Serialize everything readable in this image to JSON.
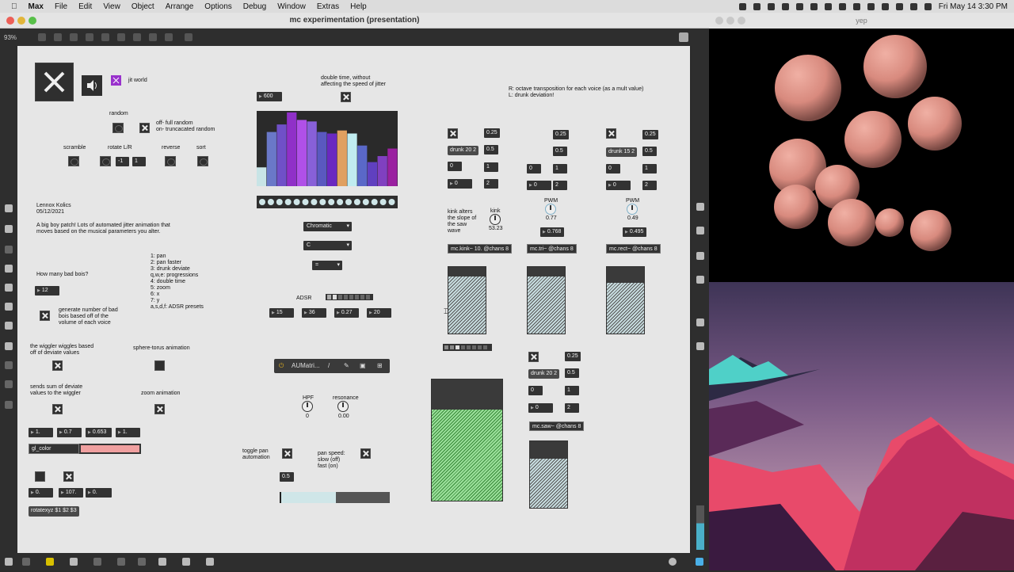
{
  "menubar": {
    "app": "Max",
    "items": [
      "File",
      "Edit",
      "View",
      "Object",
      "Arrange",
      "Options",
      "Debug",
      "Window",
      "Extras",
      "Help"
    ],
    "clock": "Fri May 14  3:30 PM"
  },
  "window": {
    "title": "mc experimentation (presentation)",
    "zoom": "93%"
  },
  "patch": {
    "jit_world_label": "jit world",
    "random_label": "random",
    "random_desc": "off- full random\non- truncacated random",
    "scramble_label": "scramble",
    "rotate_label": "rotate L/R",
    "reverse_label": "reverse",
    "sort_label": "sort",
    "rotate_val1": "-1",
    "rotate_val2": "1",
    "author": "Lennox Kolics",
    "date": "05/12/2021",
    "desc": "A big boy patch! Lots of automated jitter animation that\nmoves based on the musical parameters you alter.",
    "keys": "1: pan\n2: pan faster\n3: drunk deviate\nq,w,e: progressions\n4: double time\n5: zoom\n6: x\n7: y\na,s,d,f: ADSR presets",
    "bad_bois_label": "How many bad bois?",
    "bad_bois_val": "12",
    "generate_label": "generate number of bad\nbois based off of the\nvolume of each voice",
    "wiggler_label": "the wiggler wiggles based\noff of deviate values",
    "sphere_torus_label": "sphere-torus animation",
    "sends_sum_label": "sends sum of deviate\nvalues to the wiggler",
    "zoom_anim_label": "zoom animation",
    "color_vals": [
      "1.",
      "0.7",
      "0.653",
      "1."
    ],
    "gl_color": "gl_color",
    "rot_vals": [
      "0.",
      "107.",
      "0."
    ],
    "rotate_msg": "rotatexyz $1 $2 $3",
    "double_time_label": "double time, without\naffecting the speed of jitter",
    "tempo": "600",
    "scale_menu": "Chromatic",
    "key_menu": "C",
    "third_menu": "=",
    "adsr_label": "ADSR",
    "adsr_vals": [
      "15",
      "36",
      "0.27",
      "20"
    ],
    "plugin_name": "AUMatri...",
    "hpf_label": "HPF",
    "hpf_val": "0",
    "resonance_label": "resonance",
    "resonance_val": "0.00",
    "toggle_pan_label": "toggle pan\nautomation",
    "pan_speed_label": "pan speed:\nslow (off)\nfast (on)",
    "pan_val": "0.5",
    "rl_label": "R: octave transposition for each voice (as a mult value)\nL: drunk deviation!",
    "voices": [
      {
        "drunk": "drunk 20 2",
        "v1": "0.25",
        "v2": "0.5",
        "v3": "0",
        "v4": "1",
        "v5": "0",
        "v6": "2",
        "top": "0.25"
      },
      {
        "drunk": "",
        "v1": "0.25",
        "v2": "0.5",
        "v3": "0",
        "v4": "1",
        "v5": "0",
        "v6": "2",
        "top": ""
      },
      {
        "drunk": "drunk 15 2",
        "v1": "0.25",
        "v2": "0.5",
        "v3": "0",
        "v4": "1",
        "v5": "0",
        "v6": "2",
        "top": ""
      }
    ],
    "kink_desc": "kink alters\nthe slope of\nthe saw\nwave",
    "kink_label": "kink",
    "kink_val": "53.23",
    "pwm_label": "PWM",
    "pwm1_val": "0.77",
    "pwm2_val": "0.49",
    "pwm1_num": "0.768",
    "pwm2_num": "0.495",
    "osc1": "mc.kink~ 10. @chans 8",
    "osc2": "mc.tri~ @chans 8",
    "osc3": "mc.rect~ @chans 8",
    "saw": {
      "drunk": "drunk 20 2",
      "v1": "0.25",
      "v2": "0.5",
      "v3": "0",
      "v4": "1",
      "v5": "0",
      "v6": "2"
    },
    "osc4": "mc.saw~ @chans 8"
  },
  "multislider": {
    "bars": [
      0.25,
      0.72,
      0.82,
      0.98,
      0.88,
      0.86,
      0.72,
      0.7,
      0.74,
      0.7,
      0.54,
      0.32,
      0.4,
      0.5
    ],
    "colors": [
      "#c8e4e6",
      "#6a78c8",
      "#7050c8",
      "#9030c8",
      "#b050e8",
      "#8860d8",
      "#5a58c0",
      "#6a28c0",
      "#e0a060",
      "#c0ecf0",
      "#5a68c8",
      "#6040c0",
      "#8040c0",
      "#9a20a0"
    ]
  },
  "colors": {
    "accent": "#9932cc",
    "gl_color_swatch": "#f0a0a0",
    "green": "#9be09b",
    "sphere": "#e0958a"
  },
  "yep_title": "yep"
}
